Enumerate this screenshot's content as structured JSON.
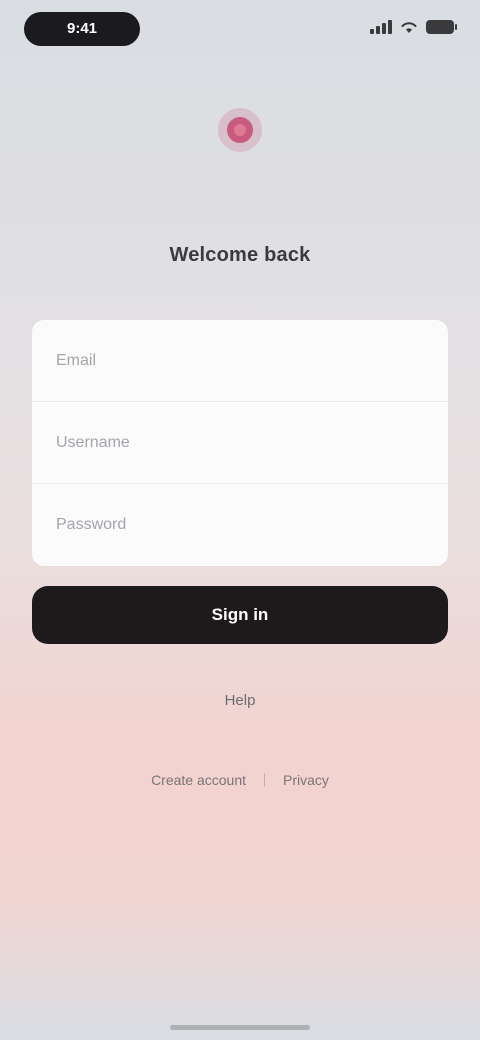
{
  "status_bar": {
    "time": "9:41",
    "icons": [
      "signal-icon",
      "wifi-icon",
      "battery-icon"
    ]
  },
  "brand": {
    "icon": "brand-logo-icon",
    "accent_color": "#c23a64"
  },
  "title": "Welcome back",
  "form": {
    "fields": [
      {
        "name": "email",
        "placeholder": "Email",
        "value": ""
      },
      {
        "name": "username",
        "placeholder": "Username",
        "value": ""
      },
      {
        "name": "password",
        "placeholder": "Password",
        "value": ""
      }
    ]
  },
  "primary_button": {
    "label": "Sign in",
    "color": "#1e1a1b"
  },
  "secondary_link": "Help",
  "footer": {
    "left_link": "Create account",
    "right_link": "Privacy"
  }
}
